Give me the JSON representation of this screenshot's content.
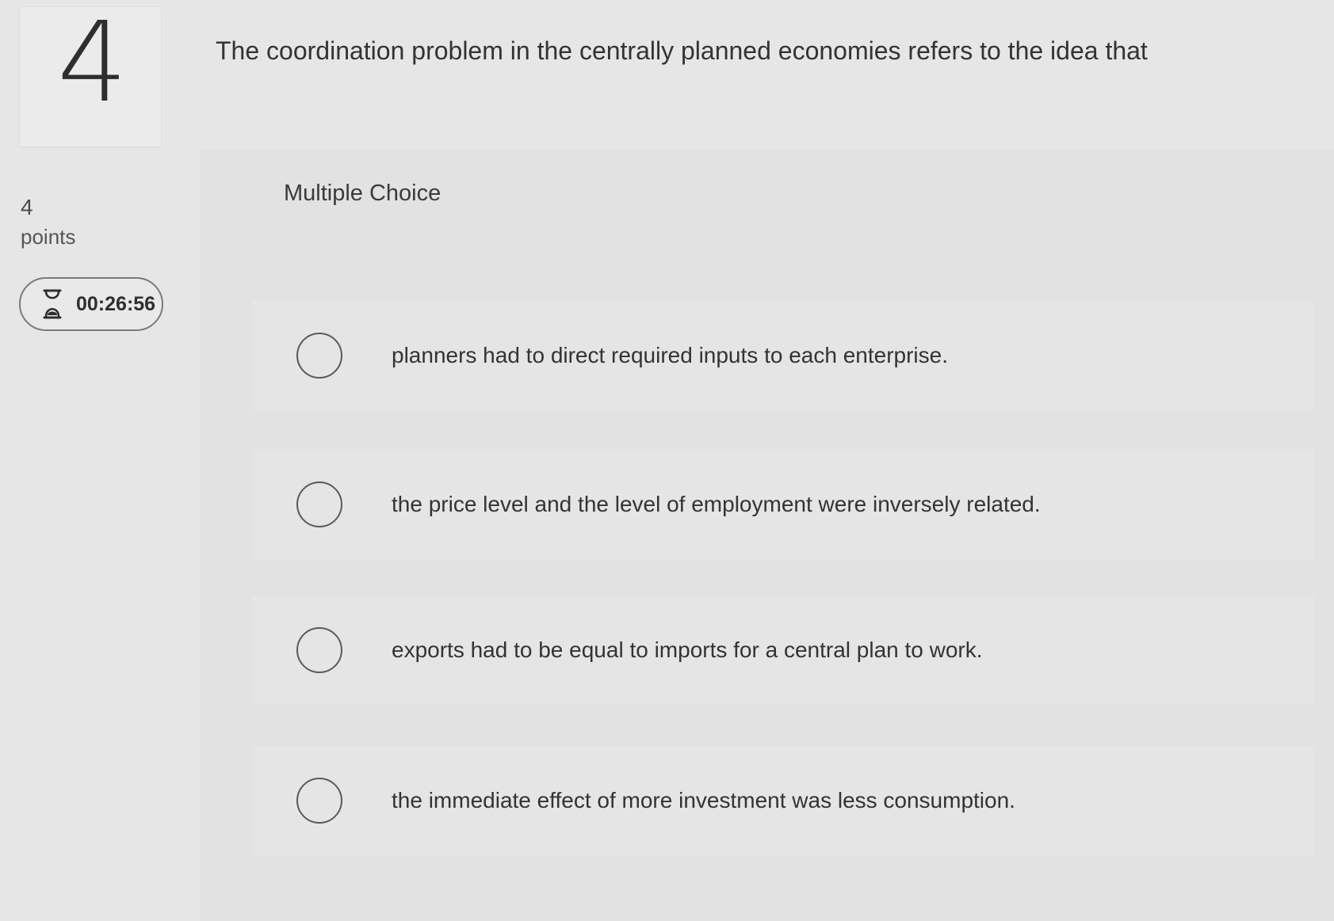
{
  "question": {
    "number": "4",
    "points_value": "4",
    "points_label": "points",
    "timer": "00:26:56",
    "timer_icon": "hourglass-icon",
    "text": "The coordination problem in the centrally planned economies refers to the idea that"
  },
  "answer_type": "Multiple Choice",
  "options": [
    {
      "label": "planners had to direct required inputs to each enterprise."
    },
    {
      "label": "the price level and the level of employment were inversely related."
    },
    {
      "label": "exports had to be equal to imports for a central plan to work."
    },
    {
      "label": "the immediate effect of more investment was less consumption."
    }
  ]
}
